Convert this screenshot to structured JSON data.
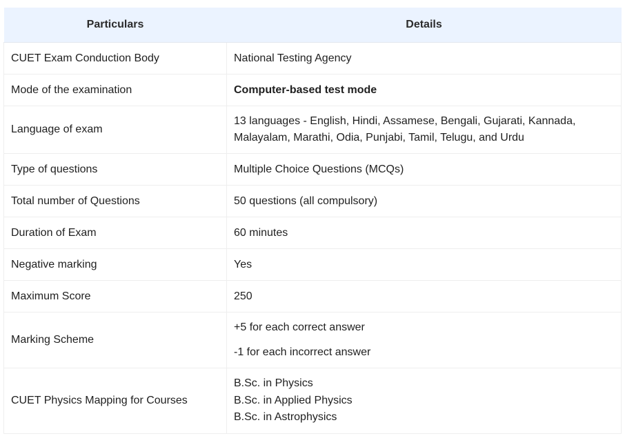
{
  "table": {
    "headers": {
      "particulars": "Particulars",
      "details": "Details"
    },
    "rows": {
      "conduction_body": {
        "label": "CUET Exam Conduction Body",
        "value": "National Testing Agency"
      },
      "mode": {
        "label": "Mode of the examination",
        "value": "Computer-based test mode"
      },
      "language": {
        "label": "Language of exam",
        "value": "13 languages - English, Hindi, Assamese, Bengali, Gujarati, Kannada, Malayalam, Marathi, Odia, Punjabi, Tamil, Telugu, and Urdu"
      },
      "question_type": {
        "label": "Type of questions",
        "value": "Multiple Choice Questions (MCQs)"
      },
      "total_questions": {
        "label": "Total number of Questions",
        "value": "50 questions (all compulsory)"
      },
      "duration": {
        "label": "Duration of Exam",
        "value": "60 minutes"
      },
      "negative_marking": {
        "label": "Negative marking",
        "value": "Yes"
      },
      "max_score": {
        "label": "Maximum Score",
        "value": "250"
      },
      "marking_scheme": {
        "label": "Marking Scheme",
        "lines": [
          "+5 for each correct answer",
          "-1 for each incorrect answer"
        ]
      },
      "course_mapping": {
        "label": "CUET Physics Mapping for Courses",
        "courses": [
          "B.Sc. in Physics",
          "B.Sc. in Applied Physics",
          "B.Sc. in Astrophysics"
        ]
      }
    }
  }
}
